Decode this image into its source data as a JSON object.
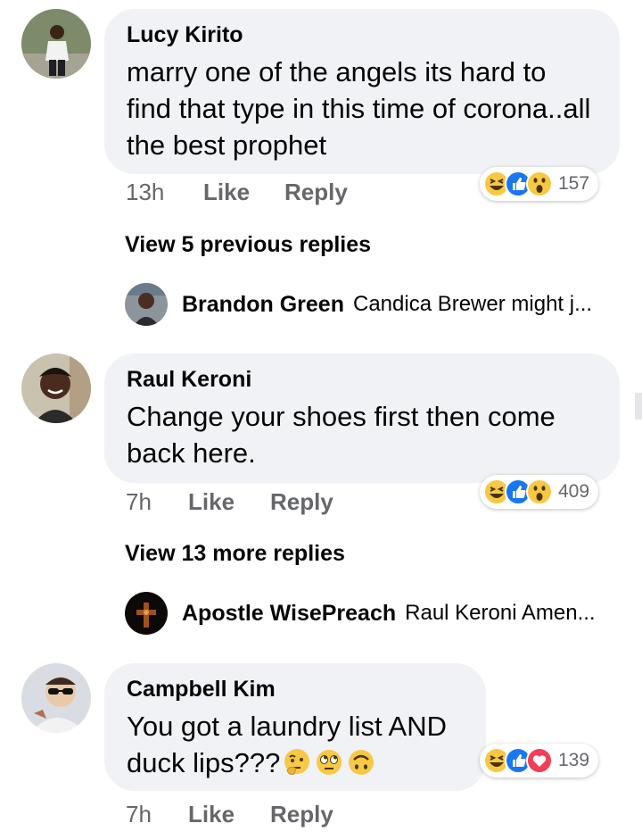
{
  "comments": [
    {
      "author": "Lucy Kirito",
      "text": "marry one of the angels  its hard to find that type in this time of corona..all the best prophet",
      "time": "13h",
      "like_label": "Like",
      "reply_label": "Reply",
      "reactions": [
        "haha",
        "like",
        "wow"
      ],
      "reaction_count": "157",
      "view_replies": "View 5 previous replies",
      "latest_reply": {
        "author": "Brandon Green",
        "snippet": "Candica Brewer might j..."
      }
    },
    {
      "author": "Raul Keroni",
      "text": "Change your shoes first then come back here.",
      "time": "7h",
      "like_label": "Like",
      "reply_label": "Reply",
      "reactions": [
        "haha",
        "like",
        "wow"
      ],
      "reaction_count": "409",
      "view_replies": "View 13 more replies",
      "latest_reply": {
        "author": "Apostle WisePreach",
        "snippet": "Raul Keroni Amen..."
      }
    },
    {
      "author": "Campbell Kim",
      "text_line1": "You got a laundry list AND",
      "text_line2": "duck lips???",
      "text_emojis": [
        "thinking-face",
        "eye-roll-face",
        "upside-down-face"
      ],
      "time": "7h",
      "like_label": "Like",
      "reply_label": "Reply",
      "reactions": [
        "haha",
        "like",
        "love"
      ],
      "reaction_count": "139"
    }
  ],
  "colors": {
    "bubble": "#f0f2f5",
    "meta_text": "#65676b",
    "like_blue": "#1877f2",
    "love_red": "#f33e58",
    "emoji_yellow": "#f7c844"
  }
}
